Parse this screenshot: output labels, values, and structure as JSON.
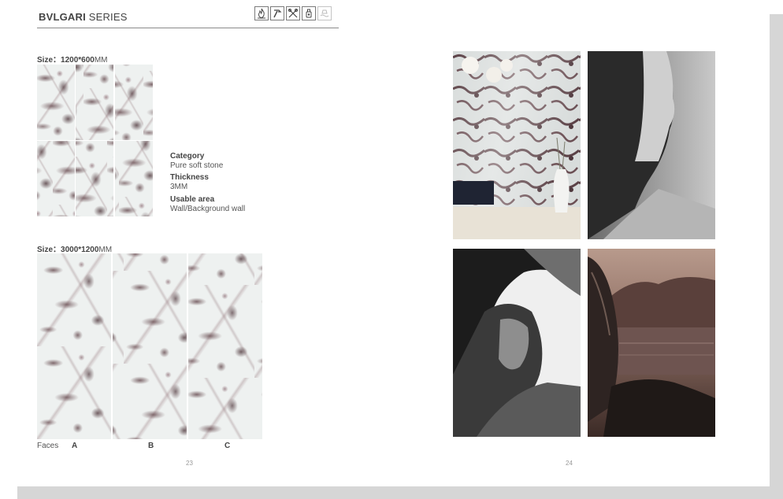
{
  "header": {
    "brand": "BVLGARI",
    "series": " SERIES",
    "icons": [
      "fire-resistant-icon",
      "hammer-icon",
      "tools-icon",
      "stain-resistant-icon",
      "water-resistant-icon"
    ]
  },
  "size_small": {
    "label": "Size：",
    "value": "1200*600",
    "unit": "MM"
  },
  "size_large": {
    "label": "Size：",
    "value": "3000*1200",
    "unit": "MM"
  },
  "specs": {
    "category_label": "Category",
    "category_value": "Pure soft stone",
    "thickness_label": "Thickness",
    "thickness_value": "3MM",
    "usable_label": "Usable area",
    "usable_value": "Wall/Background wall"
  },
  "faces": {
    "label": "Faces",
    "items": [
      "A",
      "B",
      "C"
    ]
  },
  "page_numbers": {
    "left": "23",
    "right": "24"
  },
  "photos": [
    "interior-marble-wall-photo",
    "woman-profile-photo",
    "woman-portrait-photo",
    "rock-lake-photo"
  ],
  "colors": {
    "marble_base": "#eef1f0",
    "marble_vein": "#5a3c41",
    "rule": "#8a8a8a",
    "page_shadow": "#d6d6d6"
  }
}
